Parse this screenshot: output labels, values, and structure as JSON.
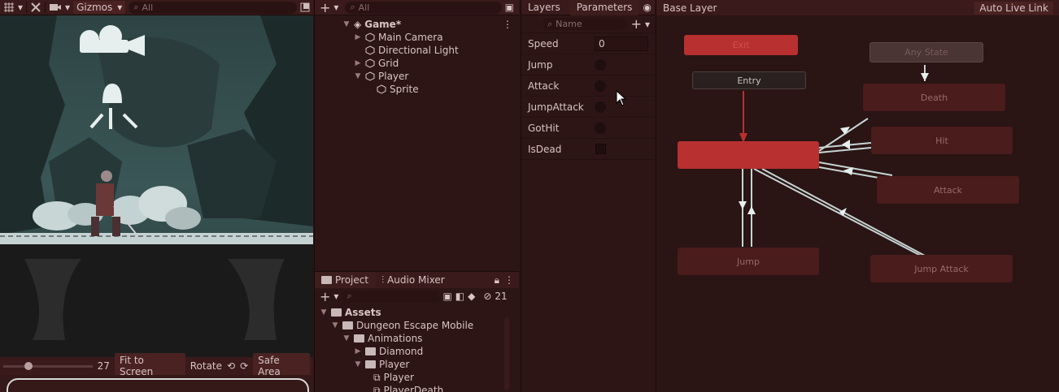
{
  "scene": {
    "toolbar": {
      "gizmos_label": "Gizmos",
      "search_placeholder": "All"
    },
    "bottom": {
      "scale_value": "27",
      "fit_to_screen": "Fit to Screen",
      "rotate": "Rotate",
      "safe_area": "Safe Area"
    }
  },
  "hierarchy": {
    "search_placeholder": "All",
    "scene_name": "Game*",
    "items": [
      {
        "label": "Main Camera",
        "expandable": true
      },
      {
        "label": "Directional Light",
        "expandable": false
      },
      {
        "label": "Grid",
        "expandable": true
      },
      {
        "label": "Player",
        "expandable": true,
        "expanded": true
      },
      {
        "label": "Sprite",
        "expandable": false,
        "child": true
      }
    ]
  },
  "project": {
    "tabs": [
      "Project",
      "Audio Mixer"
    ],
    "hidden_count": "21",
    "tree": [
      {
        "label": "Assets",
        "level": 0,
        "bold": true
      },
      {
        "label": "Dungeon Escape Mobile",
        "level": 1
      },
      {
        "label": "Animations",
        "level": 2
      },
      {
        "label": "Diamond",
        "level": 3
      },
      {
        "label": "Player",
        "level": 3
      },
      {
        "label": "Player",
        "level": 4,
        "anim": true
      },
      {
        "label": "PlayerDeath",
        "level": 4,
        "anim": true
      }
    ]
  },
  "animator": {
    "tabs": [
      "Layers",
      "Parameters"
    ],
    "search_placeholder": "Name",
    "breadcrumb": "Base Layer",
    "auto_live_link": "Auto Live Link",
    "parameters": [
      {
        "name": "Speed",
        "type": "float",
        "value": "0"
      },
      {
        "name": "Jump",
        "type": "trigger"
      },
      {
        "name": "Attack",
        "type": "trigger"
      },
      {
        "name": "JumpAttack",
        "type": "trigger"
      },
      {
        "name": "GotHit",
        "type": "trigger"
      },
      {
        "name": "IsDead",
        "type": "bool",
        "value": false
      }
    ],
    "states": {
      "exit": "Exit",
      "any_state": "Any State",
      "entry": "Entry",
      "death": "Death",
      "hit": "Hit",
      "attack": "Attack",
      "jump": "Jump",
      "jump_attack": "Jump Attack",
      "active": ""
    },
    "active_progress": 0.25
  },
  "colors": {
    "accent_red": "#b83030",
    "panel": "#2e1515",
    "state": "#4a1c1c"
  }
}
